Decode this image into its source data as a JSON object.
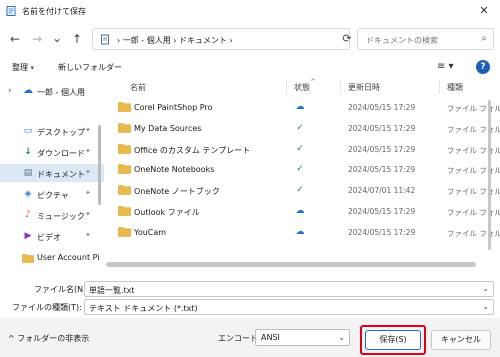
{
  "window": {
    "title": "名前を付けて保存",
    "close_glyph": "✕"
  },
  "nav": {
    "back": "←",
    "forward": "→",
    "recent": "⌄",
    "up": "↑",
    "breadcrumb": "›  一郎 - 個人用  ›  ドキュメント  ›",
    "refresh": "⟳",
    "search_placeholder": "ドキュメントの検索",
    "search_glyph": "⌕"
  },
  "toolbar": {
    "organize": "整理",
    "new_folder": "新しいフォルダー",
    "caret": "▾",
    "view_glyph": "≡ ▾",
    "help_glyph": "?"
  },
  "sidebar": {
    "items": [
      {
        "label": "一郎 - 個人用",
        "icon": "cloud-icon",
        "glyph": "☁",
        "color": "#1e73d4",
        "pinned": false,
        "selected": false,
        "expander": "›"
      },
      {
        "label": "デスクトップ",
        "icon": "desktop-icon",
        "glyph": "▭",
        "color": "#2c7be5",
        "pinned": true,
        "selected": false
      },
      {
        "label": "ダウンロード",
        "icon": "download-icon",
        "glyph": "↓",
        "color": "#1a8a4a",
        "pinned": true,
        "selected": false
      },
      {
        "label": "ドキュメント",
        "icon": "document-icon",
        "glyph": "▤",
        "color": "#5a6f8c",
        "pinned": true,
        "selected": true
      },
      {
        "label": "ピクチャ",
        "icon": "picture-icon",
        "glyph": "◈",
        "color": "#2a7fd4",
        "pinned": true,
        "selected": false
      },
      {
        "label": "ミュージック",
        "icon": "music-icon",
        "glyph": "♪",
        "color": "#e25c2a",
        "pinned": true,
        "selected": false
      },
      {
        "label": "ビデオ",
        "icon": "video-icon",
        "glyph": "▶",
        "color": "#8a2fc4",
        "pinned": true,
        "selected": false
      },
      {
        "label": "User Account Pi",
        "icon": "folder-icon",
        "glyph": "",
        "color": "#e9b949",
        "pinned": false,
        "selected": false
      }
    ],
    "pin_glyph": "📌"
  },
  "columns": {
    "name": "名前",
    "status": "状態",
    "modified": "更新日時",
    "type": "種類",
    "sort_glyph": "^"
  },
  "files": [
    {
      "name": "Corel PaintShop Pro",
      "status": "cloud",
      "status_glyph": "☁",
      "date": "2024/05/15 17:29",
      "type": "ファイル フォルダー"
    },
    {
      "name": "My Data Sources",
      "status": "synced",
      "status_glyph": "✓",
      "date": "2024/05/15 17:29",
      "type": "ファイル フォルダー"
    },
    {
      "name": "Office のカスタム テンプレート",
      "status": "synced",
      "status_glyph": "✓",
      "date": "2024/05/15 17:29",
      "type": "ファイル フォルダー"
    },
    {
      "name": "OneNote Notebooks",
      "status": "synced",
      "status_glyph": "✓",
      "date": "2024/05/15 17:29",
      "type": "ファイル フォルダー"
    },
    {
      "name": "OneNote ノートブック",
      "status": "synced",
      "status_glyph": "✓",
      "date": "2024/07/01 11:42",
      "type": "ファイル フォルダー"
    },
    {
      "name": "Outlook ファイル",
      "status": "cloud",
      "status_glyph": "☁",
      "date": "2024/05/15 17:29",
      "type": "ファイル フォルダー"
    },
    {
      "name": "YouCam",
      "status": "cloud",
      "status_glyph": "☁",
      "date": "2024/05/15 17:29",
      "type": "ファイル フォルダー"
    }
  ],
  "form": {
    "filename_label": "ファイル名(N):",
    "filename_value": "単語一覧.txt",
    "filetype_label": "ファイルの種類(T):",
    "filetype_value": "テキスト ドキュメント (*.txt)",
    "dropdown_glyph": "⌄"
  },
  "footer": {
    "hide_folders": "^  フォルダーの非表示",
    "encoding_label": "エンコード:",
    "encoding_value": "ANSI",
    "save": "保存(S)",
    "cancel": "キャンセル"
  },
  "colors": {
    "folder": "#e9b949",
    "folder_dark": "#d9a02a",
    "cloud": "#1e73d4",
    "synced": "#1a8a4a",
    "highlight": "#e0001a",
    "accent": "#1f6ed4"
  }
}
